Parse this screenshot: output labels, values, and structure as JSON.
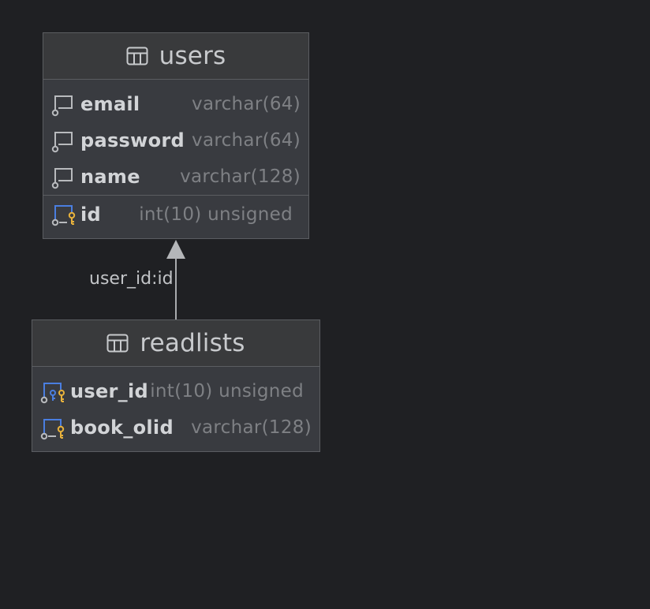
{
  "colors": {
    "background": "#1f2023",
    "table_body": "#393b40",
    "border": "#5b5d61",
    "text": "#d2d4d7",
    "type_text": "#7e8084",
    "pk_blue": "#4a7ee0",
    "key_yellow": "#e8b23c"
  },
  "tables": {
    "users": {
      "name": "users",
      "columns": [
        {
          "name": "email",
          "type": "varchar(64)",
          "icon": "column-icon"
        },
        {
          "name": "password",
          "type": "varchar(64)",
          "icon": "column-icon"
        },
        {
          "name": "name",
          "type": "varchar(128)",
          "icon": "column-icon"
        }
      ],
      "primary_key": {
        "name": "id",
        "type": "int(10) unsigned",
        "icon": "primary-key-column-icon"
      }
    },
    "readlists": {
      "name": "readlists",
      "columns": [
        {
          "name": "user_id",
          "type": "int(10) unsigned",
          "icon": "foreign-primary-key-column-icon"
        },
        {
          "name": "book_olid",
          "type": "varchar(128)",
          "icon": "primary-key-column-icon"
        }
      ]
    }
  },
  "relationship": {
    "label": "user_id:id",
    "from": "readlists",
    "to": "users"
  }
}
